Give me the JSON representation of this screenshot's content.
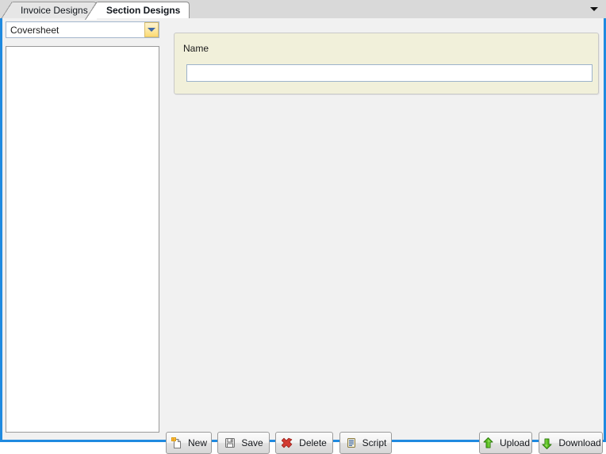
{
  "tabs": {
    "items": [
      {
        "label": "Invoice Designs",
        "active": false
      },
      {
        "label": "Section Designs",
        "active": true
      }
    ],
    "overflow_icon": "chevron-down-icon"
  },
  "left_panel": {
    "section_combo": {
      "selected": "Coversheet",
      "dropdown_icon": "chevron-down-icon"
    },
    "design_list": {
      "items": [],
      "placeholder": ""
    }
  },
  "name_group": {
    "caption": "Name",
    "input": {
      "value": "",
      "placeholder": ""
    }
  },
  "toolbar": {
    "left_buttons": [
      {
        "label": "New",
        "icon": "new-page-icon"
      },
      {
        "label": "Save",
        "icon": "floppy-disk-icon"
      },
      {
        "label": "Delete",
        "icon": "red-x-icon"
      },
      {
        "label": "Script",
        "icon": "script-document-icon"
      }
    ],
    "right_buttons": [
      {
        "label": "Upload",
        "icon": "green-up-arrow-icon"
      },
      {
        "label": "Download",
        "icon": "green-down-arrow-icon"
      }
    ]
  },
  "colors": {
    "panel_border": "#1f8ae0",
    "groupbox_background": "#f1f0da",
    "combo_button": "#fbd972",
    "delete_icon": "#cc2222",
    "arrow_icon": "#4caf16"
  }
}
